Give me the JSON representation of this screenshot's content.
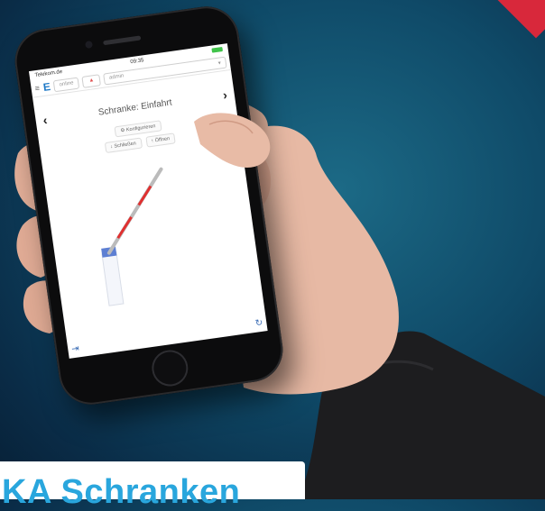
{
  "colors": {
    "background": "#0f4a68",
    "accent_red": "#d8283b",
    "brand_blue": "#1d78c6",
    "caption_blue": "#29a6dd"
  },
  "phone": {
    "status": {
      "carrier": "Telekom.de",
      "time": "09:35"
    },
    "appbar": {
      "logo": "E",
      "online_pill": "online",
      "warn_pill": "▲",
      "user_pill": "admin",
      "user_caret": "▾"
    },
    "title": "Schranke: Einfahrt",
    "nav_prev": "‹",
    "nav_next": "›",
    "configure_button": "⚙ Konfigurieren",
    "close_button": "↓ Schließen",
    "open_button": "↑ Öffnen",
    "footer": {
      "logout_icon": "⇥",
      "refresh_icon": "↻"
    }
  },
  "caption": {
    "text": "KA Schranken"
  }
}
